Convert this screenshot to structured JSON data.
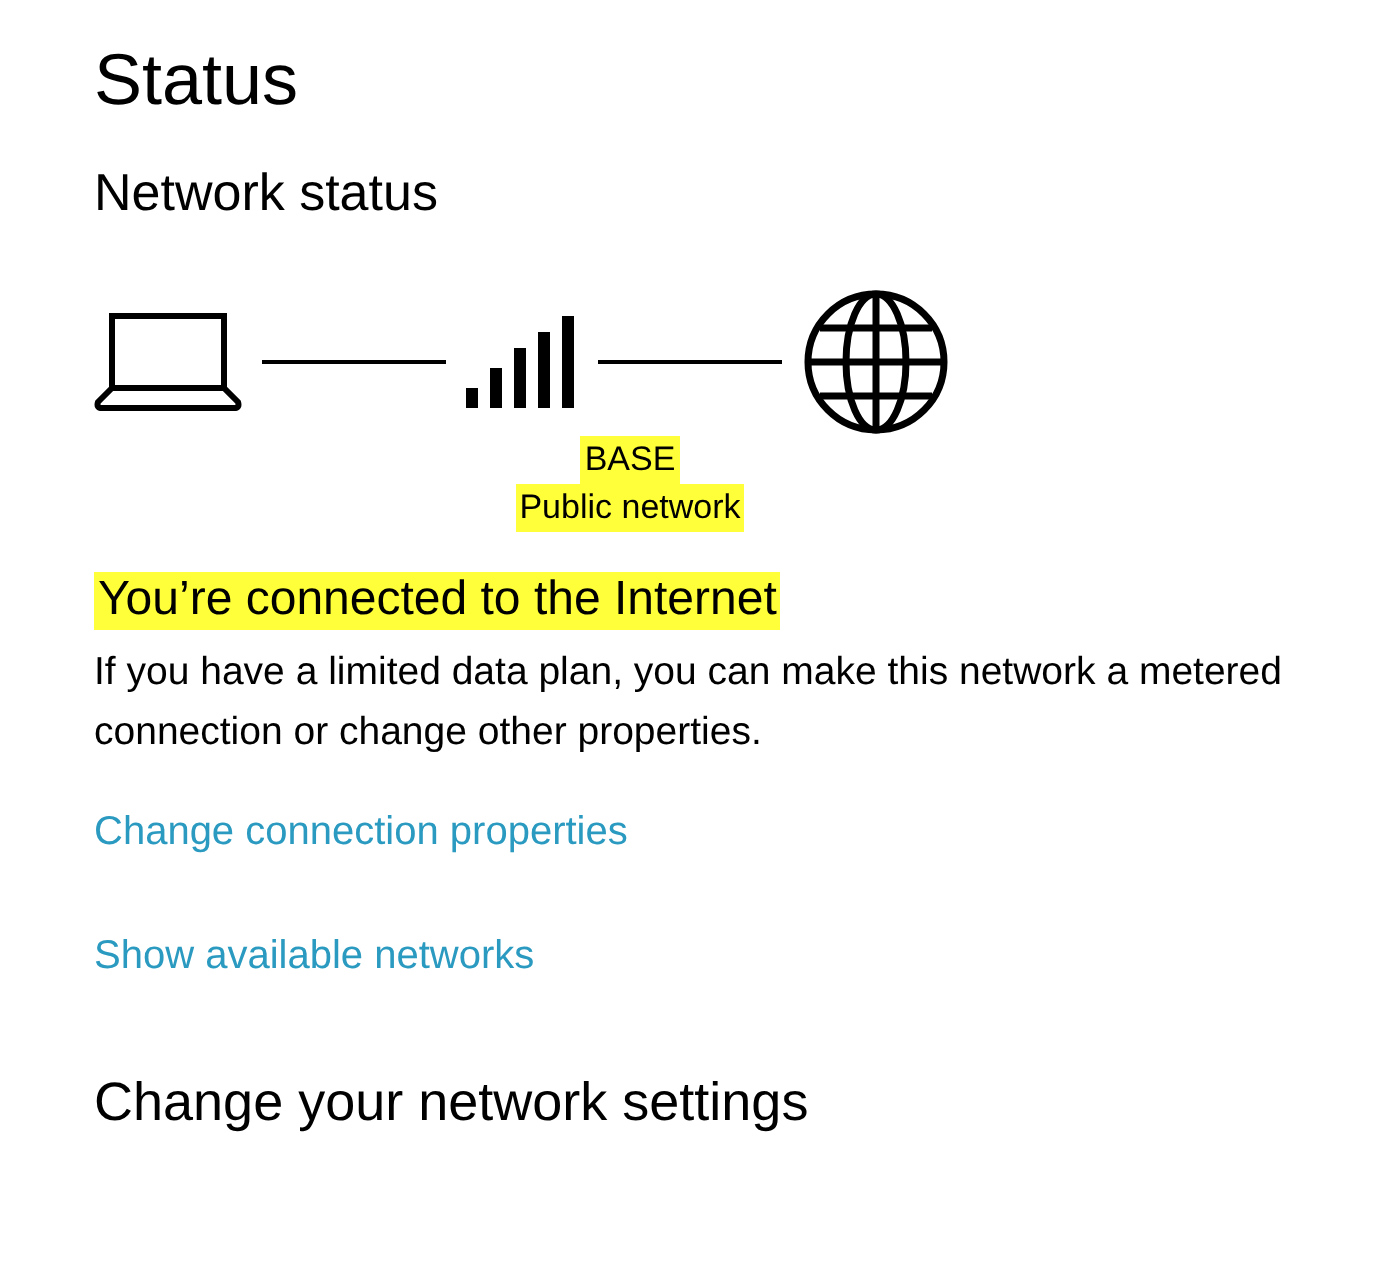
{
  "page_title": "Status",
  "section_title": "Network status",
  "network": {
    "name": "BASE",
    "profile": "Public network",
    "highlighted": true
  },
  "connection_status": {
    "text": "You’re connected to the Internet",
    "highlighted": true
  },
  "description": "If you have a limited data plan, you can make this network a metered connection or change other properties.",
  "links": [
    "Change connection properties",
    "Show available networks"
  ],
  "next_section_title": "Change your network settings"
}
